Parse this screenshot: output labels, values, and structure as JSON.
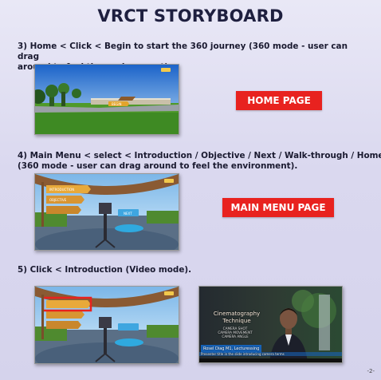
{
  "title": "VRCT STORYBOARD",
  "steps": [
    {
      "text": "3) Home < Click < Begin to start the 360 journey (360 mode - user can drag\n    around to feel the environment).",
      "label": "HOME PAGE"
    },
    {
      "text": "4) Main Menu < select < Introduction / Objective / Next / Walk-through / Home\n    (360 mode - user can drag around to feel the environment).",
      "label": "MAIN MENU PAGE"
    },
    {
      "text": "5) Click <  Introduction (Video mode)."
    }
  ],
  "video": {
    "title": "Cinematography Technique",
    "subtitle": "CAMERA SHOT\nCAMERA MOVEMENT\nCAMERA ANGLE",
    "presenter": "Rosel Diag M1, Lecturessing",
    "caption": "Presenter title in the slide introducing camera terms"
  },
  "page_number": "-2-",
  "colors": {
    "accent_red": "#e8221f",
    "title_navy": "#1e1f3f"
  }
}
